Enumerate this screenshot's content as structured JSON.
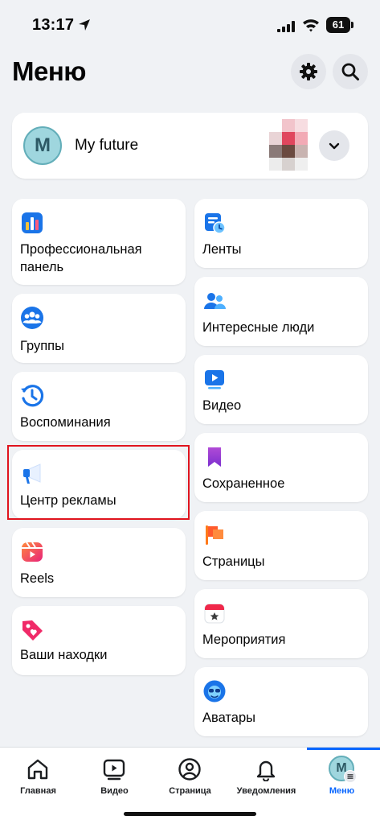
{
  "status_bar": {
    "time": "13:17",
    "battery": "61"
  },
  "header": {
    "title": "Меню"
  },
  "profile": {
    "avatar_letter": "M",
    "name": "My future"
  },
  "menu": {
    "professional_panel": "Профессиональная панель",
    "feeds": "Ленты",
    "groups": "Группы",
    "interesting_people": "Интересные люди",
    "memories": "Воспоминания",
    "video": "Видео",
    "ad_center": "Центр рекламы",
    "saved": "Сохраненное",
    "reels": "Reels",
    "pages": "Страницы",
    "your_finds": "Ваши находки",
    "events": "Мероприятия",
    "avatars": "Аватары"
  },
  "bottom_nav": {
    "home": "Главная",
    "video": "Видео",
    "page": "Страница",
    "notifications": "Уведомления",
    "menu": "Меню",
    "menu_avatar_letter": "M",
    "active": "menu"
  },
  "colors": {
    "accent": "#0866ff",
    "highlight": "#e0141e",
    "background": "#f0f2f5"
  }
}
